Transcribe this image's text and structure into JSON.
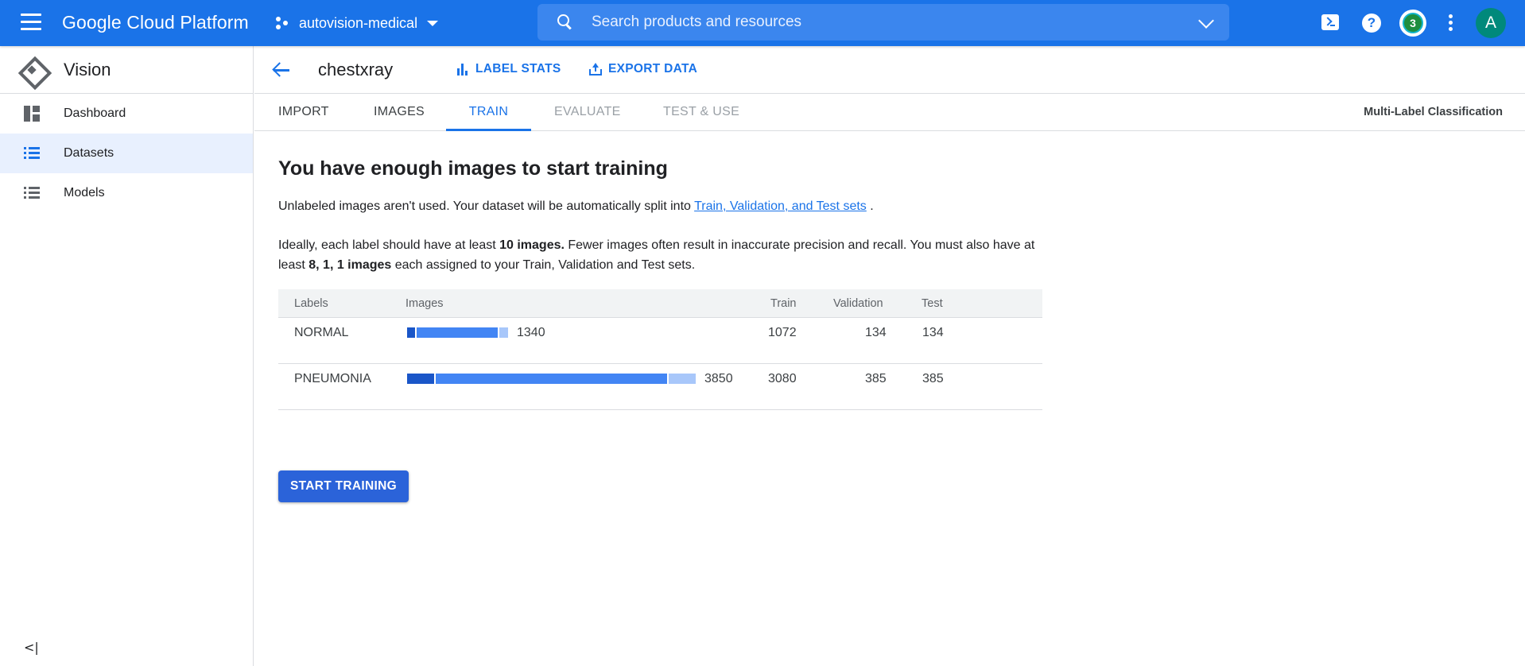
{
  "topbar": {
    "brand": "Google Cloud Platform",
    "project": "autovision-medical",
    "search_placeholder": "Search products and resources",
    "notification_count": "3",
    "avatar_letter": "A",
    "help_glyph": "?"
  },
  "sidebar": {
    "title": "Vision",
    "items": [
      {
        "label": "Dashboard",
        "icon": "dashboard-icon"
      },
      {
        "label": "Datasets",
        "icon": "list-icon",
        "active": true
      },
      {
        "label": "Models",
        "icon": "list-icon"
      }
    ],
    "collapse_glyph": "<|"
  },
  "header": {
    "dataset_name": "chestxray",
    "label_stats": "LABEL STATS",
    "export_data": "EXPORT DATA"
  },
  "tabs": [
    {
      "label": "IMPORT",
      "state": "normal"
    },
    {
      "label": "IMAGES",
      "state": "normal"
    },
    {
      "label": "TRAIN",
      "state": "active"
    },
    {
      "label": "EVALUATE",
      "state": "disabled"
    },
    {
      "label": "TEST & USE",
      "state": "disabled"
    }
  ],
  "task_type": "Multi-Label Classification",
  "content": {
    "heading": "You have enough images to start training",
    "p1_before": "Unlabeled images aren't used. Your dataset will be automatically split into ",
    "p1_link": "Train, Validation, and Test sets",
    "p1_after": " .",
    "p2_a": "Ideally, each label should have at least ",
    "p2_b": "10 images.",
    "p2_c": " Fewer images often result in inaccurate precision and recall. You must also have at least ",
    "p2_d": "8, 1, 1 images",
    "p2_e": " each assigned to your Train, Validation and Test sets.",
    "start_button": "START TRAINING"
  },
  "table": {
    "headers": [
      "Labels",
      "Images",
      "Train",
      "Validation",
      "Test"
    ],
    "rows": [
      {
        "label": "NORMAL",
        "images": "1340",
        "train": "1072",
        "validation": "134",
        "test": "134"
      },
      {
        "label": "PNEUMONIA",
        "images": "3850",
        "train": "3080",
        "validation": "385",
        "test": "385"
      }
    ]
  },
  "colors": {
    "accent": "#1a73e8",
    "bar_test": "#1a56c8",
    "bar_train": "#4285f4",
    "bar_validation": "#a8c7fa"
  }
}
